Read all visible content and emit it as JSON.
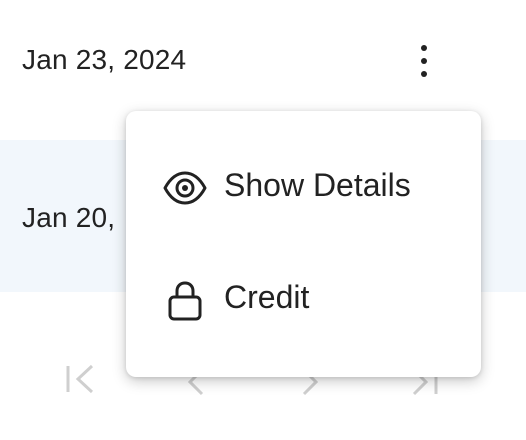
{
  "rows": [
    {
      "date": "Jan 23, 2024"
    },
    {
      "date": "Jan 20,"
    }
  ],
  "menu": {
    "items": [
      {
        "label": "Show Details",
        "icon": "eye-icon"
      },
      {
        "label": "Credit",
        "icon": "lock-icon"
      }
    ]
  },
  "colors": {
    "text": "#222222",
    "row_highlight": "#f2f7fc",
    "pager_icon": "#cfcfcf",
    "menu_background": "#ffffff"
  }
}
